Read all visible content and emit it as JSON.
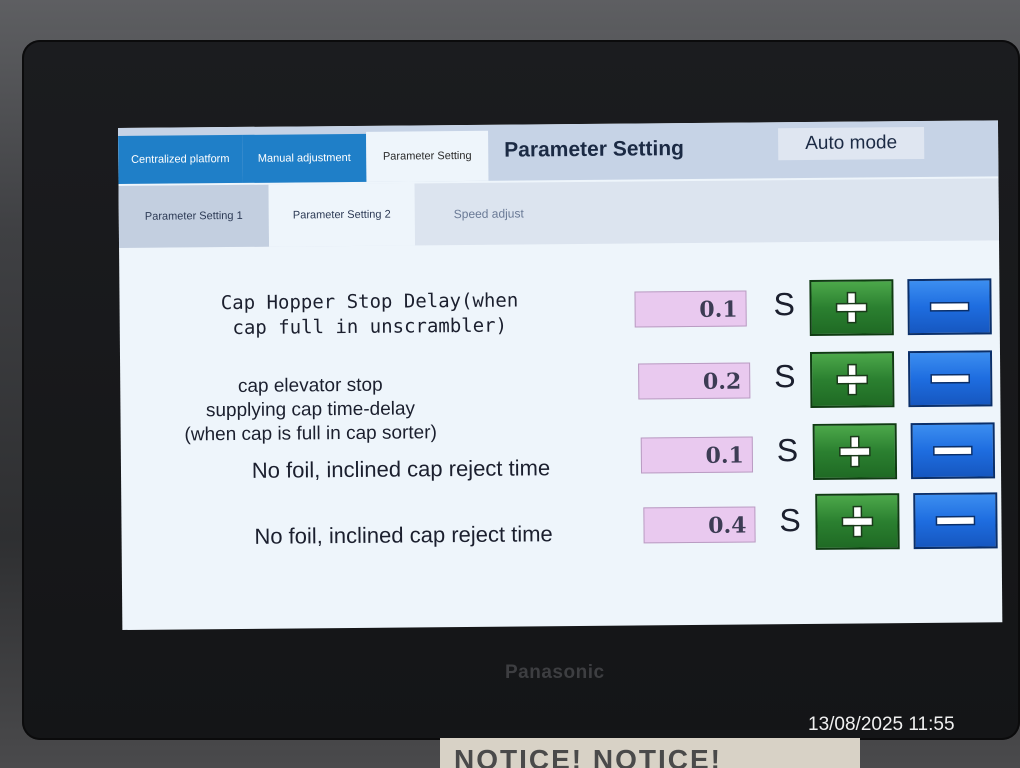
{
  "hmi": {
    "tabs": [
      {
        "label": "Centralized platform"
      },
      {
        "label": "Manual adjustment"
      },
      {
        "label": "Parameter Setting"
      }
    ],
    "title": "Parameter Setting",
    "mode": "Auto mode",
    "subtabs": [
      {
        "label": "Parameter Setting 1"
      },
      {
        "label": "Parameter Setting 2"
      },
      {
        "label": "Speed adjust"
      }
    ],
    "params": [
      {
        "line1": "Cap Hopper Stop Delay(when",
        "line2": "cap full in unscrambler)",
        "value": "0.1",
        "unit": "S"
      },
      {
        "line1": "cap elevator stop",
        "line2": "supplying cap time-delay",
        "line3": "(when cap is full in cap sorter)",
        "value": "0.2",
        "unit": "S"
      },
      {
        "line1": "No foil, inclined cap reject time",
        "value": "0.1",
        "unit": "S"
      },
      {
        "line1": "No foil, inclined cap reject time",
        "value": "0.4",
        "unit": "S"
      }
    ],
    "icons": {
      "plus": "plus-icon",
      "minus": "minus-icon"
    },
    "colors": {
      "plus_button": "#2b8030",
      "minus_button": "#1e6de0",
      "value_field": "#e9c9ef",
      "tab_blue": "#1f7fc8"
    }
  },
  "bezel": {
    "brand": "Panasonic"
  },
  "photo": {
    "timestamp": "13/08/2025 11:55",
    "notice": "NOTICE! NOTICE!"
  }
}
